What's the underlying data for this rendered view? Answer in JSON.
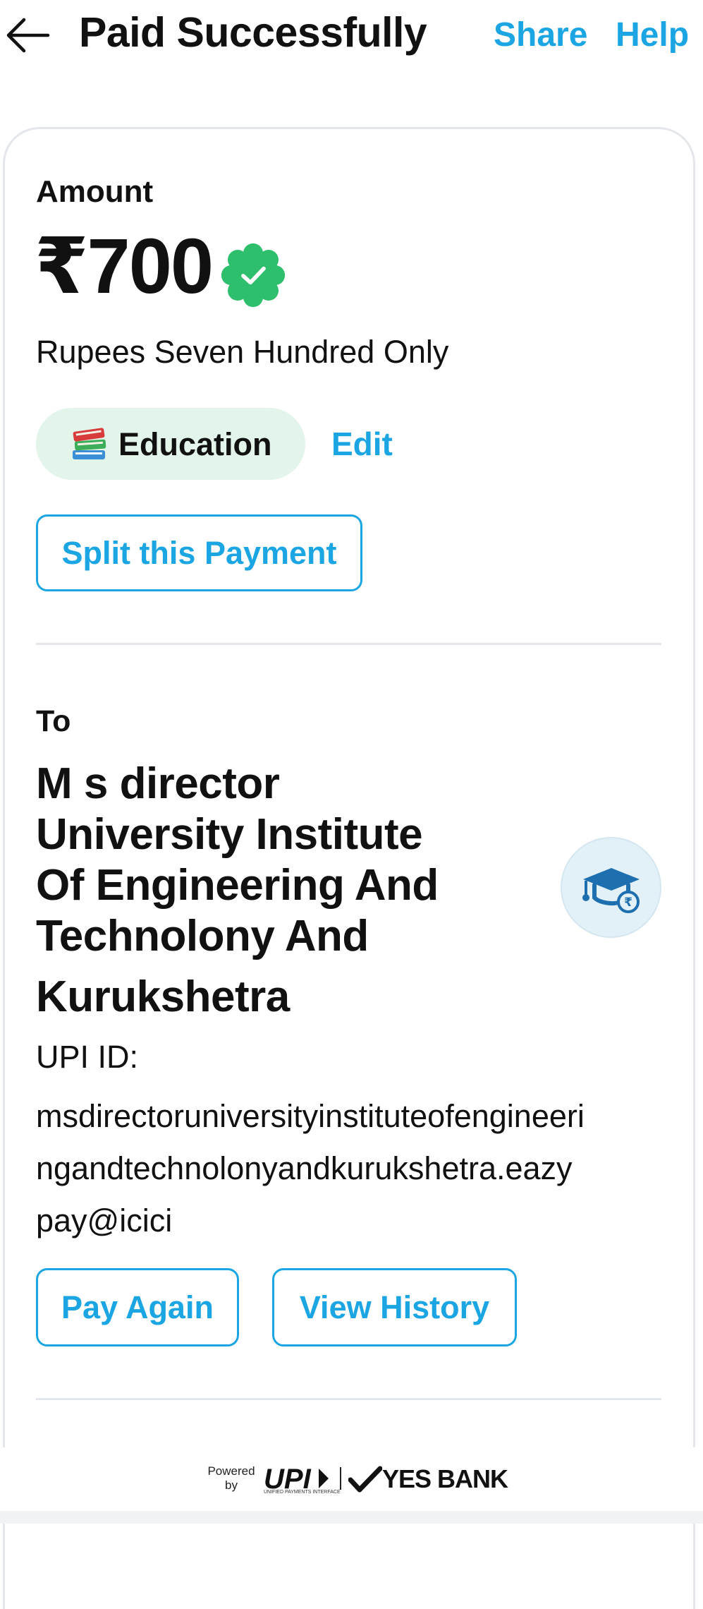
{
  "header": {
    "title": "Paid Successfully",
    "share_label": "Share",
    "help_label": "Help"
  },
  "amount": {
    "label": "Amount",
    "value": "₹700",
    "in_words": "Rupees Seven Hundred Only",
    "verified_icon": "verified-check-badge-icon"
  },
  "category": {
    "icon": "books-icon",
    "label": "Education",
    "edit_label": "Edit"
  },
  "split_button_label": "Split this Payment",
  "payee": {
    "to_label": "To",
    "name_lines": [
      "M s director",
      "University Institute",
      "Of Engineering And",
      "Technolony And",
      "Kurukshetra"
    ],
    "avatar_icon": "graduation-cap-icon",
    "upi_label": "UPI ID:",
    "upi_id": "msdirectoruniversityinstituteofengineeringandtechnolonyandkurukshetra.eazypay@icici"
  },
  "actions": {
    "pay_again_label": "Pay Again",
    "view_history_label": "View History"
  },
  "footer": {
    "powered_by": "Powered by",
    "upi_logo_text": "UPI",
    "upi_subtext": "UNIFIED PAYMENTS INTERFACE",
    "bank_name": "YES BANK"
  },
  "colors": {
    "accent": "#1ba6e3",
    "success_green": "#2dbf6c",
    "category_bg": "#e3f5ea",
    "text": "#111111"
  }
}
